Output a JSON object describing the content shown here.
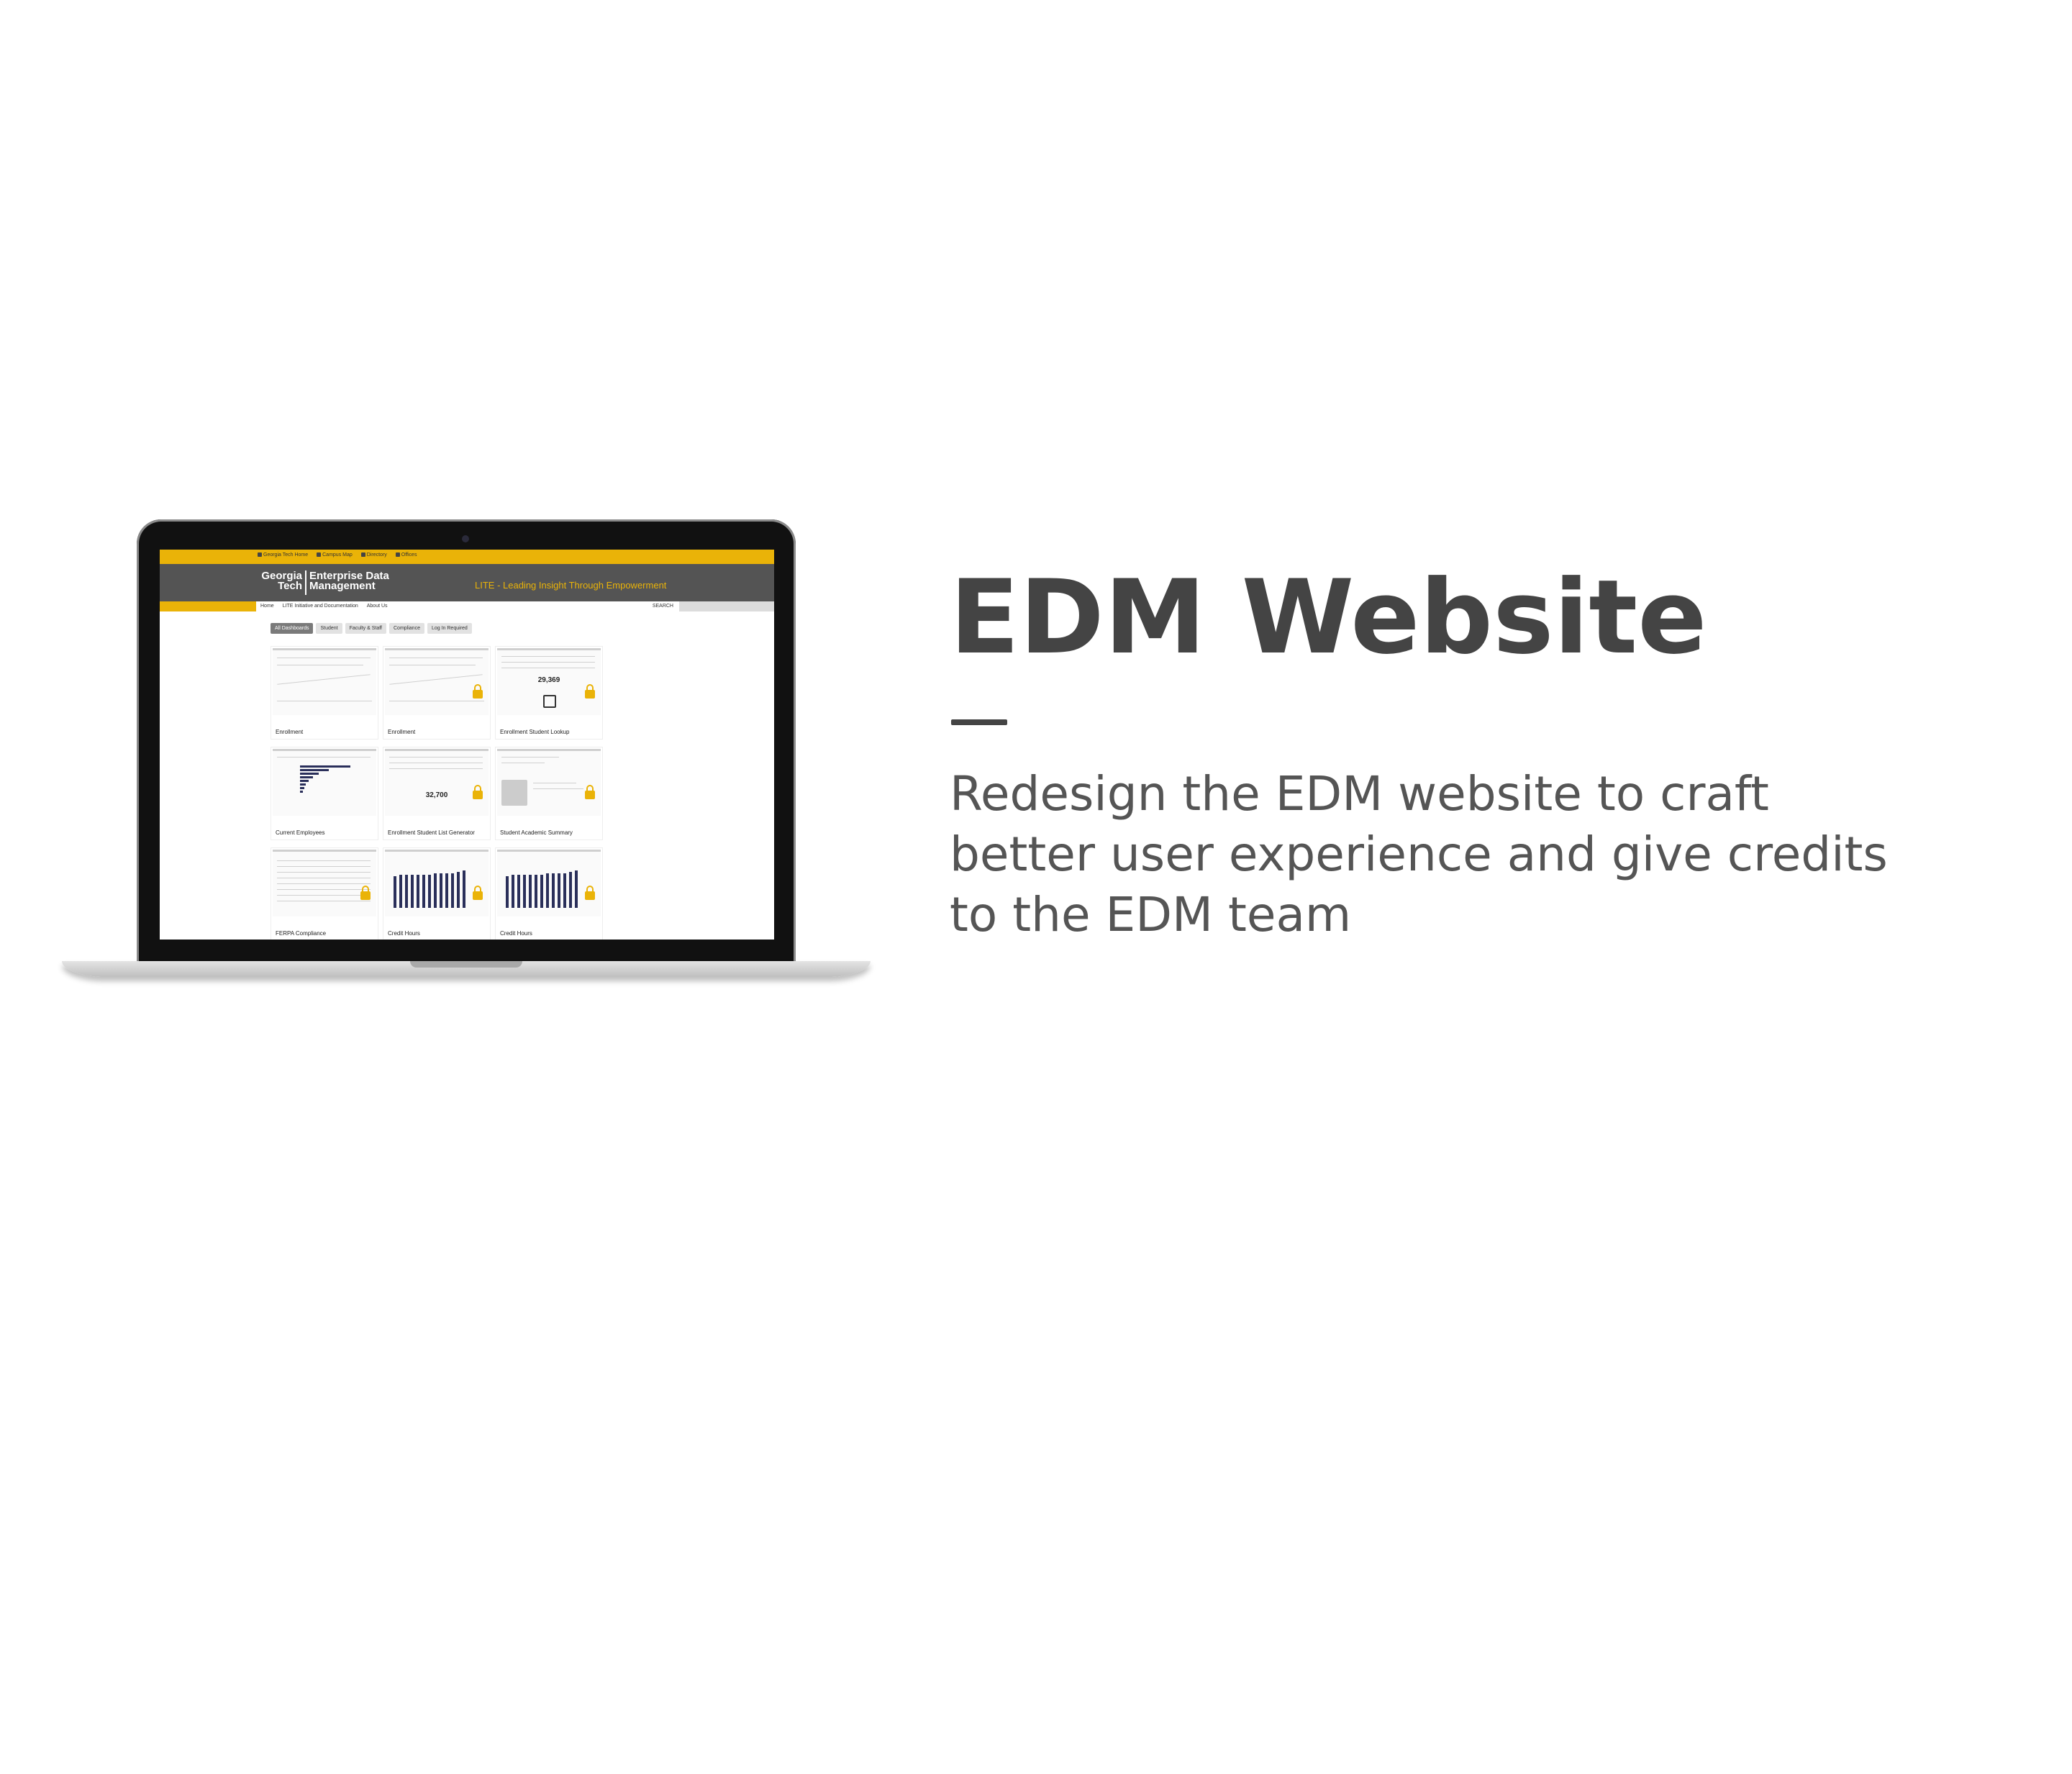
{
  "slide": {
    "title": "EDM Website",
    "description_lines": [
      "Redesign the EDM website to craft",
      "better user experience and give credits",
      "to the EDM team"
    ]
  },
  "site": {
    "utility_links": [
      "Georgia Tech Home",
      "Campus Map",
      "Directory",
      "Offices"
    ],
    "logo_left": [
      "Georgia",
      "Tech"
    ],
    "logo_right": [
      "Enterprise Data",
      "Management"
    ],
    "tagline": "LITE - Leading Insight Through Empowerment",
    "nav": [
      "Home",
      "LITE Initiative and Documentation",
      "About Us"
    ],
    "search_label": "SEARCH",
    "filter_tabs": [
      "All Dashboards",
      "Student",
      "Faculty & Staff",
      "Compliance",
      "Log In Required"
    ],
    "cards": [
      {
        "label": "Enrollment",
        "locked": false
      },
      {
        "label": "Enrollment",
        "locked": true
      },
      {
        "label": "Enrollment Student Lookup",
        "locked": true,
        "figure": "29,369"
      },
      {
        "label": "Current Employees",
        "locked": false
      },
      {
        "label": "Enrollment Student List Generator",
        "locked": true,
        "figure": "32,700"
      },
      {
        "label": "Student Academic Summary",
        "locked": true
      },
      {
        "label": "FERPA Compliance",
        "locked": true
      },
      {
        "label": "Credit Hours",
        "locked": true
      },
      {
        "label": "Credit Hours",
        "locked": true
      }
    ]
  },
  "colors": {
    "gt_gold": "#eab308",
    "header_gray": "#545454",
    "title_text": "#444444"
  }
}
